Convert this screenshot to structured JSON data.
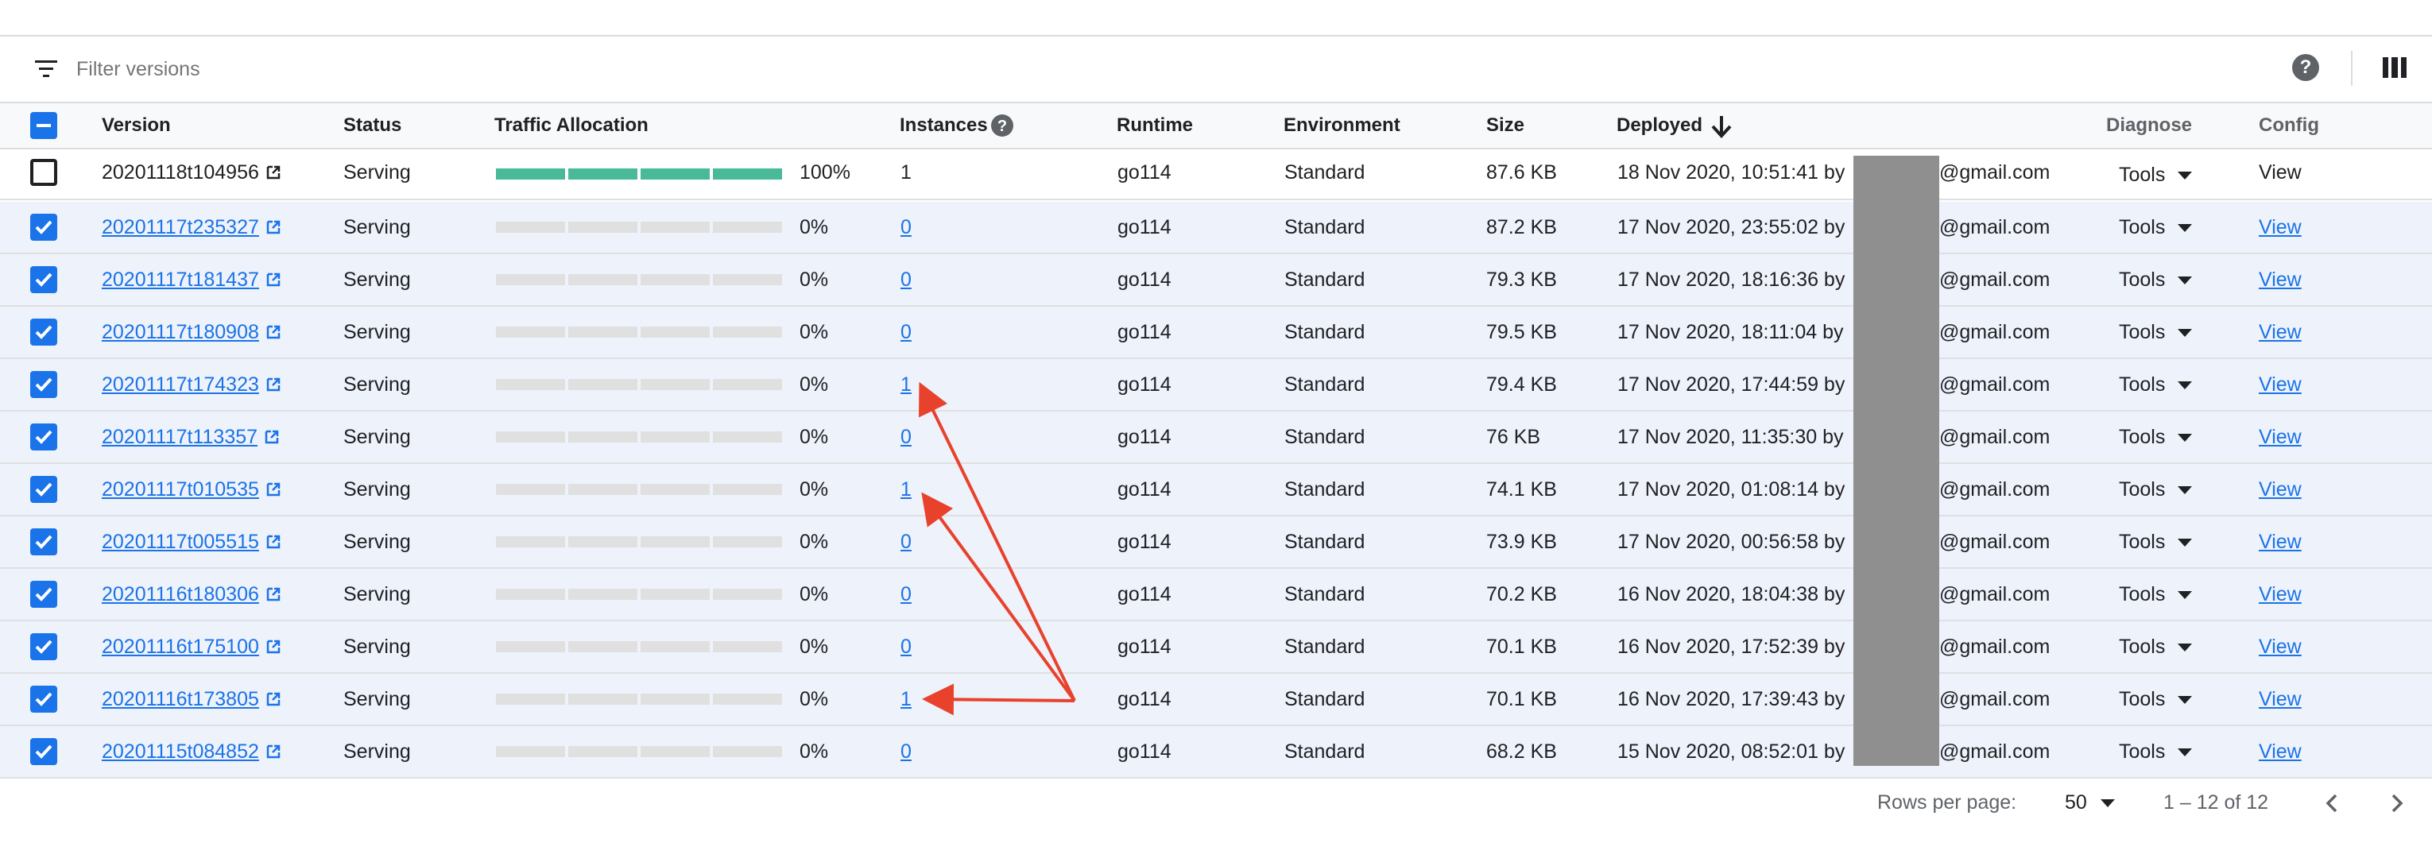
{
  "filter": {
    "placeholder": "Filter versions",
    "icon": "filter-list-icon"
  },
  "toolbar": {
    "help_icon_label": "?",
    "help_icon": "help-icon",
    "columns_icon": "view-columns-icon"
  },
  "columns": {
    "version": "Version",
    "status": "Status",
    "traffic": "Traffic Allocation",
    "instances": "Instances",
    "runtime": "Runtime",
    "environment": "Environment",
    "size": "Size",
    "deployed": "Deployed",
    "diagnose": "Diagnose",
    "config": "Config"
  },
  "sort_icon": "arrow-downward-icon",
  "rows": [
    {
      "selected": false,
      "version": "20201118t104956",
      "status": "Serving",
      "traffic": "100%",
      "traffic_fraction": 1.0,
      "instances": "1",
      "runtime": "go114",
      "environment": "Standard",
      "size": "87.6 KB",
      "deployed": "18 Nov 2020, 10:51:41 by",
      "email": "@gmail.com",
      "diagnose": "Tools",
      "config": "View"
    },
    {
      "selected": true,
      "version": "20201117t235327",
      "status": "Serving",
      "traffic": "0%",
      "traffic_fraction": 0,
      "instances": "0",
      "runtime": "go114",
      "environment": "Standard",
      "size": "87.2 KB",
      "deployed": "17 Nov 2020, 23:55:02 by",
      "email": "@gmail.com",
      "diagnose": "Tools",
      "config": "View"
    },
    {
      "selected": true,
      "version": "20201117t181437",
      "status": "Serving",
      "traffic": "0%",
      "traffic_fraction": 0,
      "instances": "0",
      "runtime": "go114",
      "environment": "Standard",
      "size": "79.3 KB",
      "deployed": "17 Nov 2020, 18:16:36 by",
      "email": "@gmail.com",
      "diagnose": "Tools",
      "config": "View"
    },
    {
      "selected": true,
      "version": "20201117t180908",
      "status": "Serving",
      "traffic": "0%",
      "traffic_fraction": 0,
      "instances": "0",
      "runtime": "go114",
      "environment": "Standard",
      "size": "79.5 KB",
      "deployed": "17 Nov 2020, 18:11:04 by",
      "email": "@gmail.com",
      "diagnose": "Tools",
      "config": "View"
    },
    {
      "selected": true,
      "version": "20201117t174323",
      "status": "Serving",
      "traffic": "0%",
      "traffic_fraction": 0,
      "instances": "1",
      "runtime": "go114",
      "environment": "Standard",
      "size": "79.4 KB",
      "deployed": "17 Nov 2020, 17:44:59 by",
      "email": "@gmail.com",
      "diagnose": "Tools",
      "config": "View"
    },
    {
      "selected": true,
      "version": "20201117t113357",
      "status": "Serving",
      "traffic": "0%",
      "traffic_fraction": 0,
      "instances": "0",
      "runtime": "go114",
      "environment": "Standard",
      "size": "76 KB",
      "deployed": "17 Nov 2020, 11:35:30 by",
      "email": "@gmail.com",
      "diagnose": "Tools",
      "config": "View"
    },
    {
      "selected": true,
      "version": "20201117t010535",
      "status": "Serving",
      "traffic": "0%",
      "traffic_fraction": 0,
      "instances": "1",
      "runtime": "go114",
      "environment": "Standard",
      "size": "74.1 KB",
      "deployed": "17 Nov 2020, 01:08:14 by",
      "email": "@gmail.com",
      "diagnose": "Tools",
      "config": "View"
    },
    {
      "selected": true,
      "version": "20201117t005515",
      "status": "Serving",
      "traffic": "0%",
      "traffic_fraction": 0,
      "instances": "0",
      "runtime": "go114",
      "environment": "Standard",
      "size": "73.9 KB",
      "deployed": "17 Nov 2020, 00:56:58 by",
      "email": "@gmail.com",
      "diagnose": "Tools",
      "config": "View"
    },
    {
      "selected": true,
      "version": "20201116t180306",
      "status": "Serving",
      "traffic": "0%",
      "traffic_fraction": 0,
      "instances": "0",
      "runtime": "go114",
      "environment": "Standard",
      "size": "70.2 KB",
      "deployed": "16 Nov 2020, 18:04:38 by",
      "email": "@gmail.com",
      "diagnose": "Tools",
      "config": "View"
    },
    {
      "selected": true,
      "version": "20201116t175100",
      "status": "Serving",
      "traffic": "0%",
      "traffic_fraction": 0,
      "instances": "0",
      "runtime": "go114",
      "environment": "Standard",
      "size": "70.1 KB",
      "deployed": "16 Nov 2020, 17:52:39 by",
      "email": "@gmail.com",
      "diagnose": "Tools",
      "config": "View"
    },
    {
      "selected": true,
      "version": "20201116t173805",
      "status": "Serving",
      "traffic": "0%",
      "traffic_fraction": 0,
      "instances": "1",
      "runtime": "go114",
      "environment": "Standard",
      "size": "70.1 KB",
      "deployed": "16 Nov 2020, 17:39:43 by",
      "email": "@gmail.com",
      "diagnose": "Tools",
      "config": "View"
    },
    {
      "selected": true,
      "version": "20201115t084852",
      "status": "Serving",
      "traffic": "0%",
      "traffic_fraction": 0,
      "instances": "0",
      "runtime": "go114",
      "environment": "Standard",
      "size": "68.2 KB",
      "deployed": "15 Nov 2020, 08:52:01 by",
      "email": "@gmail.com",
      "diagnose": "Tools",
      "config": "View"
    }
  ],
  "pagination": {
    "rows_per_page_label": "Rows per page:",
    "rows_per_page_value": "50",
    "range": "1 – 12 of 12"
  },
  "colors": {
    "accent": "#1a73e8",
    "traffic_full": "#48b999",
    "annotation": "#e8412c"
  }
}
